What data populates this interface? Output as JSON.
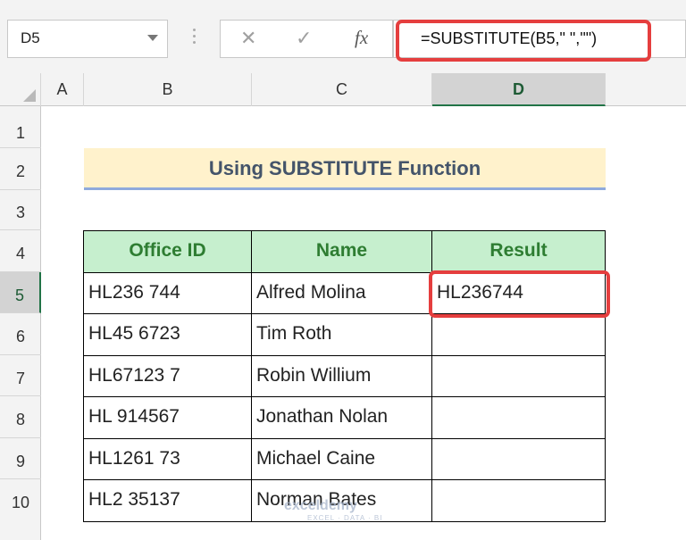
{
  "name_box": {
    "value": "D5"
  },
  "formula_bar": {
    "cancel_symbol": "✕",
    "enter_symbol": "✓",
    "fx_label": "fx",
    "formula": "=SUBSTITUTE(B5,\" \",\"\")"
  },
  "columns": [
    "A",
    "B",
    "C",
    "D"
  ],
  "rows": [
    "1",
    "2",
    "3",
    "4",
    "5",
    "6",
    "7",
    "8",
    "9",
    "10"
  ],
  "selected": {
    "column": "D",
    "row": "5"
  },
  "title": "Using SUBSTITUTE Function",
  "table": {
    "headers": [
      "Office ID",
      "Name",
      "Result"
    ],
    "rows": [
      [
        "HL236 744",
        "Alfred Molina",
        "HL236744"
      ],
      [
        "HL45 6723",
        "Tim Roth",
        ""
      ],
      [
        "HL67123 7",
        "Robin Willium",
        ""
      ],
      [
        "HL 914567",
        "Jonathan Nolan",
        ""
      ],
      [
        "HL1261 73",
        "Michael Caine",
        ""
      ],
      [
        "HL2 35137",
        "Norman Bates",
        ""
      ]
    ]
  },
  "watermark": {
    "brand": "exceldemy",
    "tagline": "EXCEL · DATA · BI"
  },
  "colors": {
    "highlight": "#e53e3e",
    "header_fill": "#c6efce",
    "title_fill": "#fff2cc"
  }
}
